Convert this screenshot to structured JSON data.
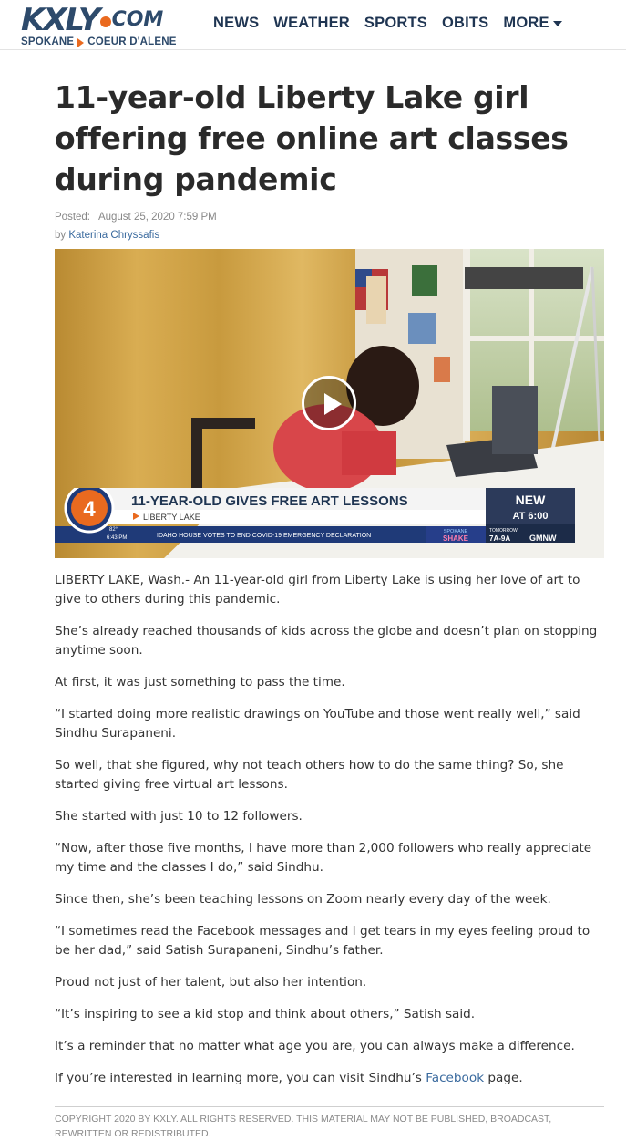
{
  "site": {
    "logo_main": "KXLY",
    "logo_com": "COM",
    "logo_city_1": "SPOKANE",
    "logo_city_2": "COEUR D'ALENE",
    "colors": {
      "brand_blue": "#2d4a6b",
      "brand_orange": "#ea6a1f",
      "link": "#3a6a9e"
    }
  },
  "nav": {
    "items": [
      {
        "label": "NEWS"
      },
      {
        "label": "WEATHER"
      },
      {
        "label": "SPORTS"
      },
      {
        "label": "OBITS"
      },
      {
        "label": "MORE",
        "icon": "caret-down-icon"
      }
    ]
  },
  "article": {
    "title": "11-year-old Liberty Lake girl offering free online art classes during pandemic",
    "posted_label": "Posted:",
    "posted_date": "August 25, 2020 7:59 PM",
    "by_label": "by",
    "author": "Katerina Chryssafis",
    "video": {
      "play_icon": "play-icon",
      "headline": "11-YEAR-OLD GIVES FREE ART LESSONS",
      "location": "LIBERTY LAKE",
      "temp": "82°",
      "time": "6:43 PM",
      "ticker": "IDAHO HOUSE VOTES TO END COVID-19 EMERGENCY DECLARATION",
      "new_label": "NEW",
      "new_time": "AT 6:00",
      "show_city": "SPOKANE",
      "show_name": "SHAKE",
      "tomorrow_label": "TOMORROW",
      "tomorrow_time": "7A-9A",
      "gmnw": "GMNW",
      "channel": "4"
    },
    "paragraphs": [
      "LIBERTY LAKE, Wash.- An 11-year-old girl from Liberty Lake is using her love of art to give to others during this pandemic.",
      "She’s already reached thousands of kids across the globe and doesn’t plan on stopping anytime soon.",
      "At first, it was just something to pass the time.",
      "“I started doing more realistic drawings on YouTube and those went really well,” said Sindhu Surapaneni.",
      "So well, that she figured, why not teach others how to do the same thing? So, she started giving free virtual art lessons.",
      "She started with just 10 to 12 followers.",
      "“Now, after those five months, I have more than 2,000 followers who really appreciate my time and the classes I do,” said Sindhu.",
      "Since then, she’s been teaching lessons on Zoom nearly every day of the week.",
      "“I sometimes read the Facebook messages and I get tears in my eyes feeling proud to be her dad,” said Satish Surapaneni, Sindhu’s father.",
      "Proud not just of her talent, but also her intention.",
      "“It’s inspiring to see a kid stop and think about others,” Satish said.",
      "It’s a reminder that no matter what age you are, you can always make a difference."
    ],
    "last_paragraph": {
      "before": "If you’re interested in learning more, you can visit Sindhu’s ",
      "link": "Facebook",
      "after": " page."
    },
    "copyright": "COPYRIGHT 2020 BY KXLY. ALL RIGHTS RESERVED. THIS MATERIAL MAY NOT BE PUBLISHED, BROADCAST, REWRITTEN OR REDISTRIBUTED."
  }
}
